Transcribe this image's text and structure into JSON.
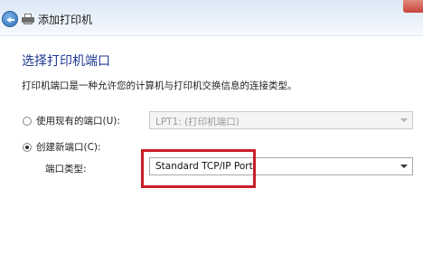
{
  "window": {
    "title": "添加打印机",
    "back_icon": "back-arrow-icon",
    "printer_icon": "printer-icon"
  },
  "page": {
    "heading": "选择打印机端口",
    "description": "打印机端口是一种允许您的计算机与打印机交换信息的连接类型。"
  },
  "options": {
    "existing_port": {
      "label": "使用现有的端口(U):",
      "selected": false,
      "select_value": "LPT1: (打印机端口)",
      "enabled": false
    },
    "new_port": {
      "label": "创建新端口(C):",
      "selected": true,
      "type_label": "端口类型:",
      "select_value": "Standard TCP/IP Port"
    }
  },
  "colors": {
    "heading": "#1f3a93",
    "highlight": "#c81e28"
  }
}
